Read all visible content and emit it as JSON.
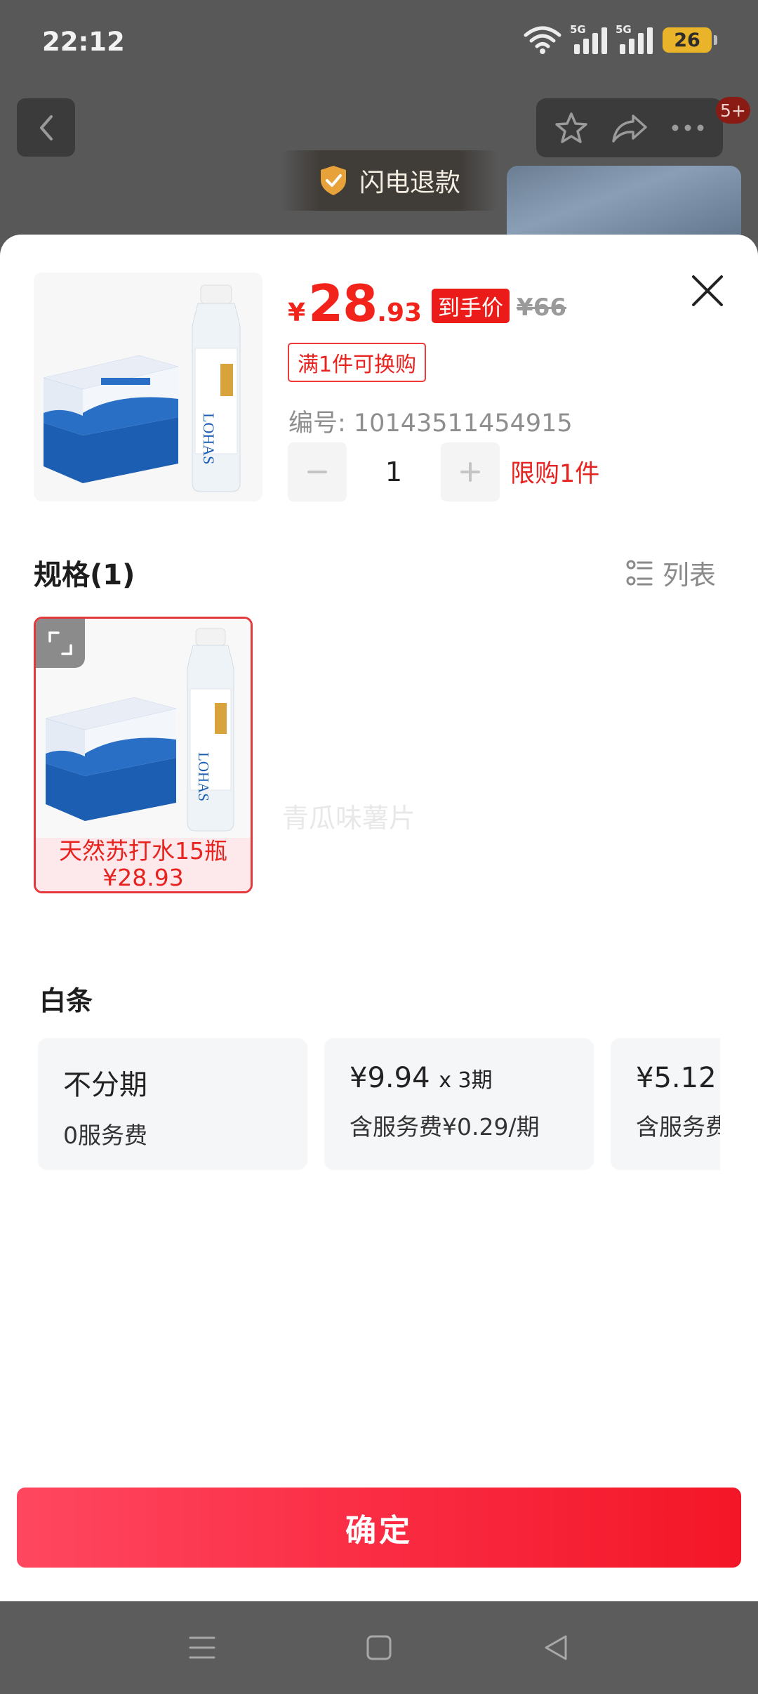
{
  "status_bar": {
    "time": "22:12",
    "battery": "26",
    "network_label_1": "5G",
    "network_label_2": "5G"
  },
  "background_page": {
    "cart_badge": "5+",
    "refund_banner": "闪电退款"
  },
  "product": {
    "currency": "¥",
    "price_int": "28",
    "price_dec": ".93",
    "final_price_tag": "到手价",
    "original_price": "¥66",
    "promo_tag": "满1件可换购",
    "sku_line": "编号: 10143511454915",
    "quantity": "1",
    "limit_text": "限购1件"
  },
  "spec": {
    "title": "规格(1)",
    "list_toggle_label": "列表",
    "options": [
      {
        "name": "天然苏打水15瓶",
        "price": "¥28.93",
        "selected": true
      }
    ]
  },
  "watermark": "青瓜味薯片",
  "baitiao": {
    "title": "白条",
    "plans": [
      {
        "main": "不分期",
        "sub": "0服务费"
      },
      {
        "main": "¥9.94",
        "main_suffix": "x 3期",
        "sub": "含服务费¥0.29/期"
      },
      {
        "main": "¥5.12",
        "main_suffix": "",
        "sub": "含服务费"
      }
    ]
  },
  "confirm_label": "确定",
  "colors": {
    "accent": "#f2231a",
    "confirm_start": "#ff4760",
    "confirm_end": "#f31627",
    "card_bg": "#f5f6f8"
  }
}
